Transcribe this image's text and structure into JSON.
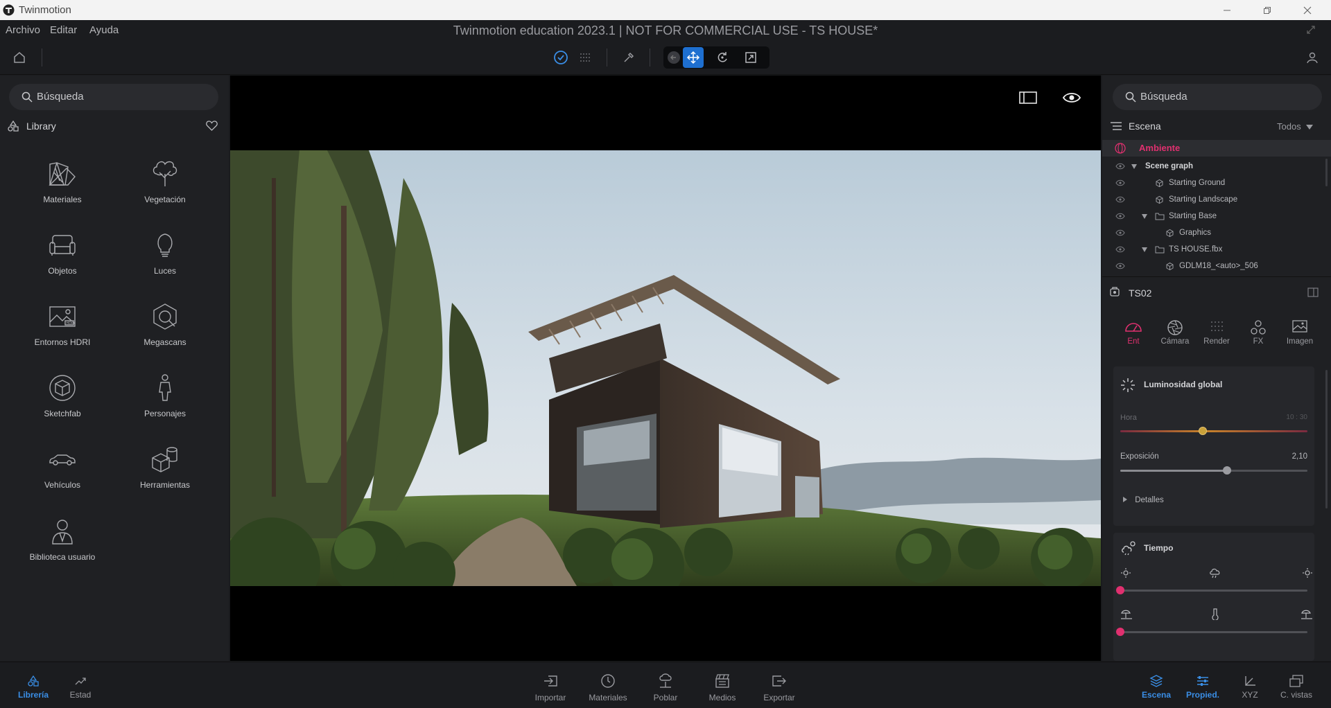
{
  "window": {
    "app_name": "Twinmotion",
    "doc_title": "Twinmotion education 2023.1 | NOT FOR COMMERCIAL USE - TS HOUSE*"
  },
  "menu": [
    "Archivo",
    "Editar",
    "Ayuda"
  ],
  "left_panel": {
    "search_placeholder": "Búsqueda",
    "library_title": "Library",
    "items": [
      {
        "label": "Materiales",
        "icon": "materials-icon"
      },
      {
        "label": "Vegetación",
        "icon": "vegetation-icon"
      },
      {
        "label": "Objetos",
        "icon": "sofa-icon"
      },
      {
        "label": "Luces",
        "icon": "lightbulb-icon"
      },
      {
        "label": "Entornos HDRI",
        "icon": "hdri-icon"
      },
      {
        "label": "Megascans",
        "icon": "megascans-icon"
      },
      {
        "label": "Sketchfab",
        "icon": "sketchfab-icon"
      },
      {
        "label": "Personajes",
        "icon": "person-icon"
      },
      {
        "label": "Vehículos",
        "icon": "car-icon"
      },
      {
        "label": "Herramientas",
        "icon": "tools-icon"
      },
      {
        "label": "Biblioteca usuario",
        "icon": "user-library-icon"
      }
    ]
  },
  "right_panel": {
    "search_placeholder": "Búsqueda",
    "scene_title": "Escena",
    "filter": "Todos",
    "ambient": "Ambiente",
    "tree": [
      {
        "label": "Scene graph",
        "indent": 0,
        "type": "root"
      },
      {
        "label": "Starting Ground",
        "indent": 1,
        "type": "object"
      },
      {
        "label": "Starting Landscape",
        "indent": 1,
        "type": "object"
      },
      {
        "label": "Starting Base",
        "indent": 1,
        "type": "folder"
      },
      {
        "label": "Graphics",
        "indent": 2,
        "type": "object"
      },
      {
        "label": "TS HOUSE.fbx",
        "indent": 1,
        "type": "folder"
      },
      {
        "label": "GDLM18_<auto>_506",
        "indent": 2,
        "type": "object"
      }
    ],
    "selection": "TS02",
    "prop_tabs": [
      {
        "label": "Ent",
        "active": true
      },
      {
        "label": "Cámara",
        "active": false
      },
      {
        "label": "Render",
        "active": false
      },
      {
        "label": "FX",
        "active": false
      },
      {
        "label": "Imagen",
        "active": false
      }
    ],
    "global_light": {
      "title": "Luminosidad global",
      "hora_label": "Hora",
      "hora_value": "10 : 30",
      "hora_fraction": 0.44,
      "exposure_label": "Exposición",
      "exposure_value": "2,10",
      "exposure_fraction": 0.57,
      "details": "Detalles"
    },
    "weather": {
      "title": "Tiempo",
      "slider1_fraction": 0.0,
      "slider2_fraction": 0.0
    }
  },
  "bottom_bar": {
    "left": [
      {
        "label": "Librería",
        "active": true
      },
      {
        "label": "Estad",
        "active": false
      }
    ],
    "center": [
      "Importar",
      "Materiales",
      "Poblar",
      "Medios",
      "Exportar"
    ],
    "right": [
      {
        "label": "Escena",
        "active": true
      },
      {
        "label": "Propied.",
        "active": true
      },
      {
        "label": "XYZ",
        "active": false
      },
      {
        "label": "C. vistas",
        "active": false
      }
    ]
  },
  "colors": {
    "accent_pink": "#e0306f",
    "accent_blue": "#3a8ee6",
    "panel_bg": "#1f2023"
  }
}
